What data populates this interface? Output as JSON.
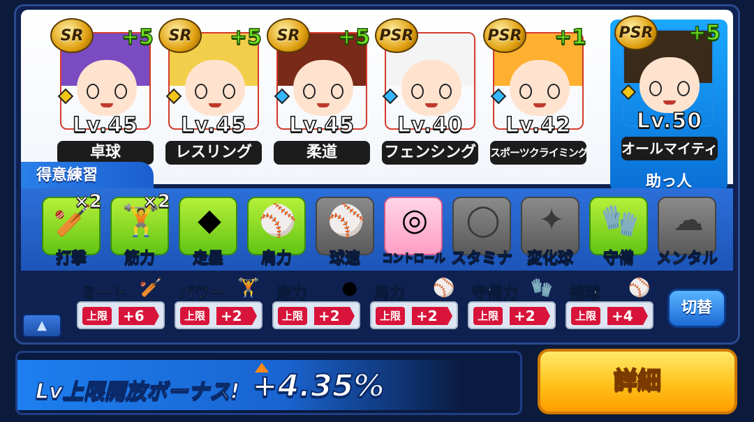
{
  "cards": [
    {
      "rarity": "SR",
      "plus": "+5",
      "level": "Lv.45",
      "name": "卓球",
      "gem": "yellow",
      "hair": "#7b4bc2",
      "accent": "#d43a2a"
    },
    {
      "rarity": "SR",
      "plus": "+5",
      "level": "Lv.45",
      "name": "レスリング",
      "gem": "yellow",
      "hair": "#f2cf4a",
      "accent": "#d43a2a"
    },
    {
      "rarity": "SR",
      "plus": "+5",
      "level": "Lv.45",
      "name": "柔道",
      "gem": "blue",
      "hair": "#7a2a18",
      "accent": "#d43a2a"
    },
    {
      "rarity": "PSR",
      "plus": "",
      "level": "Lv.40",
      "name": "フェンシング",
      "gem": "blue",
      "hair": "#f4f4f4",
      "accent": "#d43a2a"
    },
    {
      "rarity": "PSR",
      "plus": "+1",
      "level": "Lv.42",
      "name": "スポーツクライミング",
      "gem": "blue",
      "hair": "#ffb030",
      "accent": "#d43a2a"
    },
    {
      "rarity": "PSR",
      "plus": "+5",
      "level": "Lv.50",
      "name": "オールマイティ",
      "gem": "yellow",
      "hair": "#3a2a1a",
      "accent": "#1c8ce6"
    }
  ],
  "helper_label": "助っ人",
  "practice_title": "得意練習",
  "practices": [
    {
      "label": "打撃",
      "icon": "bat-icon",
      "glyph": "🏏",
      "active": true,
      "mult": "×2"
    },
    {
      "label": "筋力",
      "icon": "dumbbell-icon",
      "glyph": "🏋",
      "active": true,
      "mult": "×2"
    },
    {
      "label": "走塁",
      "icon": "base-icon",
      "glyph": "◆",
      "active": true,
      "mult": ""
    },
    {
      "label": "肩力",
      "icon": "throw-ball-icon",
      "glyph": "⚾",
      "active": true,
      "mult": ""
    },
    {
      "label": "球速",
      "icon": "speed-ball-icon",
      "glyph": "⚾",
      "active": false,
      "mult": ""
    },
    {
      "label": "コントロール",
      "icon": "target-icon",
      "glyph": "◎",
      "active": true,
      "target": true,
      "mult": ""
    },
    {
      "label": "スタミナ",
      "icon": "tire-icon",
      "glyph": "◯",
      "active": false,
      "mult": ""
    },
    {
      "label": "変化球",
      "icon": "breaking-ball-icon",
      "glyph": "✦",
      "active": false,
      "mult": ""
    },
    {
      "label": "守備",
      "icon": "glove-icon",
      "glyph": "🧤",
      "active": true,
      "mult": ""
    },
    {
      "label": "メンタル",
      "icon": "mental-cloud-icon",
      "glyph": "☁",
      "active": false,
      "mult": ""
    }
  ],
  "stats": [
    {
      "name": "ミート",
      "icon": "bat-icon",
      "glyph": "🏏",
      "limit": "上限",
      "value": "+6"
    },
    {
      "name": "パワー",
      "icon": "dumbbell-icon",
      "glyph": "🏋",
      "limit": "上限",
      "value": "+2"
    },
    {
      "name": "走力",
      "icon": "runner-icon",
      "glyph": "●",
      "limit": "上限",
      "value": "+2"
    },
    {
      "name": "肩力",
      "icon": "throw-ball-icon",
      "glyph": "⚾",
      "limit": "上限",
      "value": "+2"
    },
    {
      "name": "守備力",
      "icon": "glove-icon",
      "glyph": "🧤",
      "limit": "上限",
      "value": "+2"
    },
    {
      "name": "捕球",
      "icon": "catch-ball-icon",
      "glyph": "⚾",
      "limit": "上限",
      "value": "+4"
    }
  ],
  "switch_label": "切替",
  "bonus_label": "Lv上限開放ボーナス!",
  "bonus_value": "+4.35%",
  "detail_label": "詳細"
}
